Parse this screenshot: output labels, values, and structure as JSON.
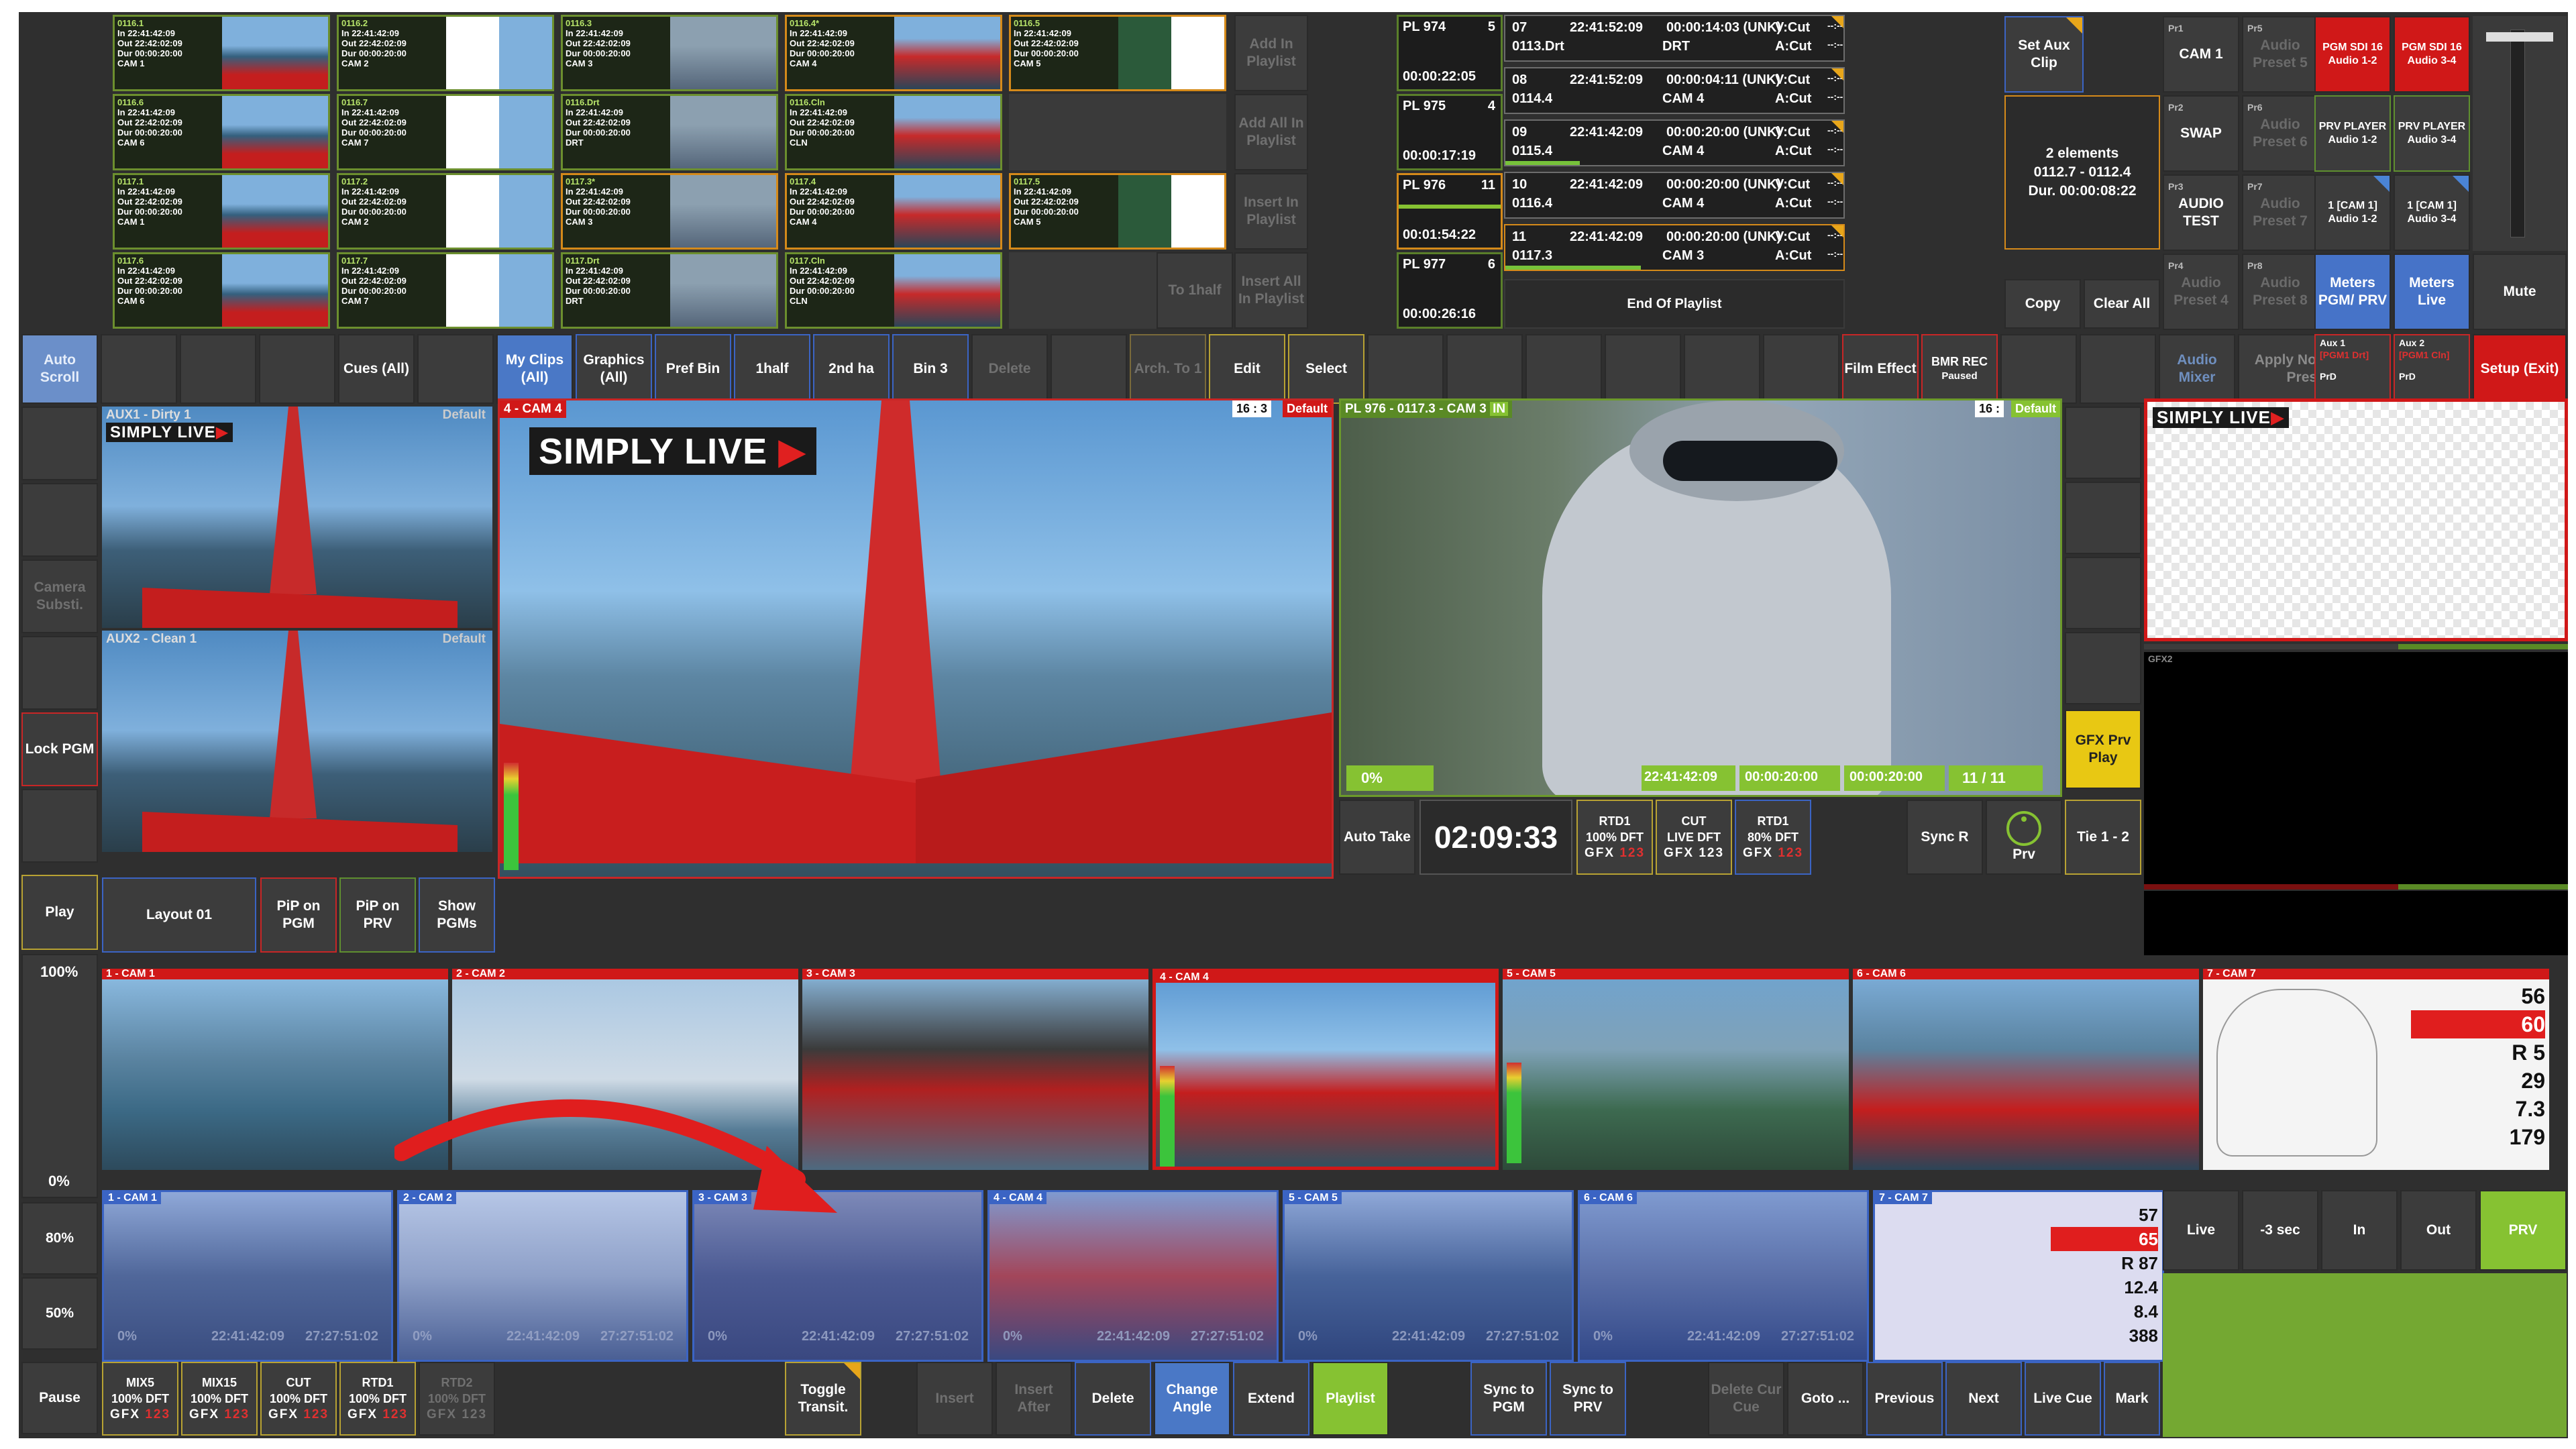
{
  "clips": [
    {
      "id": "0116.1",
      "in": "22:41:42:09",
      "out": "22:42:02:09",
      "dur": "00:00:20:00",
      "cam": "CAM 1"
    },
    {
      "id": "0116.2",
      "in": "22:41:42:09",
      "out": "22:42:02:09",
      "dur": "00:00:20:00",
      "cam": "CAM 2"
    },
    {
      "id": "0116.3",
      "in": "22:41:42:09",
      "out": "22:42:02:09",
      "dur": "00:00:20:00",
      "cam": "CAM 3"
    },
    {
      "id": "0116.4*",
      "in": "22:41:42:09",
      "out": "22:42:02:09",
      "dur": "00:00:20:00",
      "cam": "CAM 4"
    },
    {
      "id": "0116.5",
      "in": "22:41:42:09",
      "out": "22:42:02:09",
      "dur": "00:00:20:00",
      "cam": "CAM 5"
    },
    {
      "id": "0116.6",
      "in": "22:41:42:09",
      "out": "22:42:02:09",
      "dur": "00:00:20:00",
      "cam": "CAM 6"
    },
    {
      "id": "0116.7",
      "in": "22:41:42:09",
      "out": "22:42:02:09",
      "dur": "00:00:20:00",
      "cam": "CAM 7"
    },
    {
      "id": "0116.Drt",
      "in": "22:41:42:09",
      "out": "22:42:02:09",
      "dur": "00:00:20:00",
      "cam": "DRT"
    },
    {
      "id": "0116.Cln",
      "in": "22:41:42:09",
      "out": "22:42:02:09",
      "dur": "00:00:20:00",
      "cam": "CLN"
    },
    {
      "id": "0117.1",
      "in": "22:41:42:09",
      "out": "22:42:02:09",
      "dur": "00:00:20:00",
      "cam": "CAM 1"
    },
    {
      "id": "0117.2",
      "in": "22:41:42:09",
      "out": "22:42:02:09",
      "dur": "00:00:20:00",
      "cam": "CAM 2"
    },
    {
      "id": "0117.3*",
      "in": "22:41:42:09",
      "out": "22:42:02:09",
      "dur": "00:00:20:00",
      "cam": "CAM 3"
    },
    {
      "id": "0117.4",
      "in": "22:41:42:09",
      "out": "22:42:02:09",
      "dur": "00:00:20:00",
      "cam": "CAM 4"
    },
    {
      "id": "0117.5",
      "in": "22:41:42:09",
      "out": "22:42:02:09",
      "dur": "00:00:20:00",
      "cam": "CAM 5"
    },
    {
      "id": "0117.6",
      "in": "22:41:42:09",
      "out": "22:42:02:09",
      "dur": "00:00:20:00",
      "cam": "CAM 6"
    },
    {
      "id": "0117.7",
      "in": "22:41:42:09",
      "out": "22:42:02:09",
      "dur": "00:00:20:00",
      "cam": "CAM 7"
    },
    {
      "id": "0117.Drt",
      "in": "22:41:42:09",
      "out": "22:42:02:09",
      "dur": "00:00:20:00",
      "cam": "DRT"
    },
    {
      "id": "0117.Cln",
      "in": "22:41:42:09",
      "out": "22:42:02:09",
      "dur": "00:00:20:00",
      "cam": "CLN"
    }
  ],
  "clip_labels": {
    "in": "In",
    "out": "Out",
    "dur": "Dur"
  },
  "playlist_side": {
    "add": "Add In Playlist",
    "add_all": "Add All In Playlist",
    "insert": "Insert In Playlist",
    "insert_all": "Insert All In Playlist",
    "to_half": "To 1half"
  },
  "playlists": [
    {
      "name": "PL 974",
      "num": "5",
      "dur": "00:00:22:05"
    },
    {
      "name": "PL 975",
      "num": "4",
      "dur": "00:00:17:19"
    },
    {
      "name": "PL 976",
      "num": "11",
      "dur": "00:01:54:22"
    },
    {
      "name": "PL 977",
      "num": "6",
      "dur": "00:00:26:16"
    }
  ],
  "pl_entries": [
    {
      "n": "07",
      "tc": "22:41:52:09",
      "dur": "00:00:14:03 (UNK)",
      "id": "0113.Drt",
      "cam": "DRT",
      "v": "V:Cut",
      "a": "A:Cut",
      "x": "--:--"
    },
    {
      "n": "08",
      "tc": "22:41:52:09",
      "dur": "00:00:04:11 (UNK)",
      "id": "0114.4",
      "cam": "CAM 4",
      "v": "V:Cut",
      "a": "A:Cut",
      "x": "--:--"
    },
    {
      "n": "09",
      "tc": "22:41:42:09",
      "dur": "00:00:20:00 (UNK)",
      "id": "0115.4",
      "cam": "CAM 4",
      "v": "V:Cut",
      "a": "A:Cut",
      "x": "--:--"
    },
    {
      "n": "10",
      "tc": "22:41:42:09",
      "dur": "00:00:20:00 (UNK)",
      "id": "0116.4",
      "cam": "CAM 4",
      "v": "V:Cut",
      "a": "A:Cut",
      "x": "--:--"
    },
    {
      "n": "11",
      "tc": "22:41:42:09",
      "dur": "00:00:20:00 (UNK)",
      "id": "0117.3",
      "cam": "CAM 3",
      "v": "V:Cut",
      "a": "A:Cut",
      "x": "--:--"
    }
  ],
  "end_of_playlist": "End Of Playlist",
  "aux_panel": {
    "set_aux": "Set Aux Clip",
    "elements": "2 elements",
    "range": "0112.7 - 0112.4",
    "dur": "Dur. 00:00:08:22",
    "copy": "Copy",
    "clear_all": "Clear All"
  },
  "presets": [
    {
      "sup": "Pr1",
      "label": "CAM 1"
    },
    {
      "sup": "Pr5",
      "label": "Audio Preset 5"
    },
    {
      "sup": "Pr2",
      "label": "SWAP"
    },
    {
      "sup": "Pr6",
      "label": "Audio Preset 6"
    },
    {
      "sup": "Pr3",
      "label": "AUDIO TEST"
    },
    {
      "sup": "Pr7",
      "label": "Audio Preset 7"
    },
    {
      "sup": "Pr4",
      "label": "Audio Preset 4"
    },
    {
      "sup": "Pr8",
      "label": "Audio Preset 8"
    }
  ],
  "audio_out": {
    "pgm1": "PGM SDI 16 Audio 1-2",
    "pgm2": "PGM SDI 16 Audio 3-4",
    "prv1": "PRV PLAYER Audio 1-2",
    "prv2": "PRV PLAYER Audio 3-4",
    "cam1a": "1 [CAM 1] Audio 1-2",
    "cam1b": "1 [CAM 1] Audio 3-4",
    "meters1": "Meters PGM/ PRV",
    "meters2": "Meters Live",
    "mute": "Mute"
  },
  "row2": {
    "auto_scroll": "Auto Scroll",
    "cues": "Cues (All)",
    "my_clips": "My Clips (All)",
    "graphics": "Graphics (All)",
    "pref_bin": "Pref Bin",
    "half1": "1half",
    "half2": "2nd ha",
    "bin3": "Bin 3",
    "delete": "Delete",
    "arch": "Arch. To 1",
    "edit": "Edit",
    "select": "Select",
    "film": "Film Effect",
    "bmr": "BMR REC",
    "bmr_status": "Paused",
    "audio_mixer": "Audio Mixer",
    "apply": "Apply Now! [More Presets]",
    "aux1": "Aux 1",
    "aux1b": "[PGM1 Drt]",
    "aux2": "Aux 2",
    "aux2b": "[PGM1 Cln]",
    "prd": "PrD",
    "setup": "Setup (Exit)"
  },
  "left": {
    "camera_subst": "Camera Substi.",
    "lock_pgm": "Lock PGM",
    "play": "Play",
    "pct100": "100%",
    "pct0": "0%",
    "pct80": "80%",
    "pct50": "50%",
    "pause": "Pause"
  },
  "aux1_view": {
    "label": "AUX1 - Dirty 1",
    "default": "Default"
  },
  "aux2_view": {
    "label": "AUX2 - Clean 1",
    "default": "Default"
  },
  "pgm_view": {
    "label": "4 - CAM 4",
    "ratio": "16 : 3",
    "default": "Default"
  },
  "prv_view": {
    "label": "PL 976 - 0117.3 - CAM 3",
    "in": "IN",
    "ratio": "16 :",
    "default": "Default",
    "pct": "0%",
    "tc1": "22:41:42:09",
    "tc2": "00:00:20:00",
    "tc3": "00:00:20:00",
    "count": "11 / 11"
  },
  "logo": {
    "text": "SIMPLY LIVE",
    "arrow": "▶"
  },
  "gfx_prv": "GFX Prv Play",
  "gfx2": "GFX2",
  "under": {
    "auto_take": "Auto Take",
    "clock": "02:09:33",
    "rtd1a": "RTD1",
    "rtd1a_sub": "100% DFT",
    "cut": "CUT",
    "cut_sub": "LIVE DFT",
    "rtd1b": "RTD1",
    "rtd1b_sub": "80% DFT",
    "gfx": "GFX",
    "gfx_n": "123",
    "sync_r": "Sync R",
    "prv": "Prv",
    "tie": "Tie 1 - 2"
  },
  "layout_row": {
    "layout": "Layout 01",
    "pip_pgm": "PiP on PGM",
    "pip_prv": "PiP on PRV",
    "show": "Show PGMs"
  },
  "live_cams": [
    "1 - CAM 1",
    "2 - CAM 2",
    "3 - CAM 3",
    "4 - CAM 4",
    "5 - CAM 5",
    "6 - CAM 6",
    "7 - CAM 7"
  ],
  "replay_cams": [
    "1 - CAM 1",
    "2 - CAM 2",
    "3 - CAM 3",
    "4 - CAM 4",
    "5 - CAM 5",
    "6 - CAM 6",
    "7 - CAM 7"
  ],
  "replay_info": {
    "pct": "0%",
    "tc1": "22:41:42:09",
    "tc2": "27:27:51:02"
  },
  "cam7_stats": [
    "56",
    "60",
    "R 5",
    "29",
    "7.3",
    "179"
  ],
  "cam7r_stats": [
    "57",
    "65",
    "R 87",
    "12.4",
    "8.4",
    "388"
  ],
  "right_mode": {
    "live": "Live",
    "minus3": "-3 sec",
    "in": "In",
    "out": "Out",
    "prv": "PRV"
  },
  "bottom": {
    "mix5": "MIX5",
    "mix5_sub": "100% DFT",
    "mix15": "MIX15",
    "mix15_sub": "100% DFT",
    "cut": "CUT",
    "cut_sub": "100% DFT",
    "rtd1": "RTD1",
    "rtd1_sub": "100% DFT",
    "rtd2": "RTD2",
    "rtd2_sub": "100% DFT",
    "toggle": "Toggle Transit.",
    "insert": "Insert",
    "insert_after": "Insert After",
    "delete": "Delete",
    "change": "Change Angle",
    "extend": "Extend",
    "playlist": "Playlist",
    "sync_pgm": "Sync to PGM",
    "sync_prv": "Sync to PRV",
    "delete_cue": "Delete Cur Cue",
    "goto": "Goto ...",
    "previous": "Previous",
    "next": "Next",
    "live_cue": "Live Cue",
    "mark": "Mark"
  },
  "colors": {
    "panel": "#2f2f2f",
    "button": "#3c3c3c",
    "green": "#86c232",
    "red": "#d01818",
    "blue": "#3b64c4",
    "yellow": "#e8c813",
    "orange": "#e8a61a"
  }
}
